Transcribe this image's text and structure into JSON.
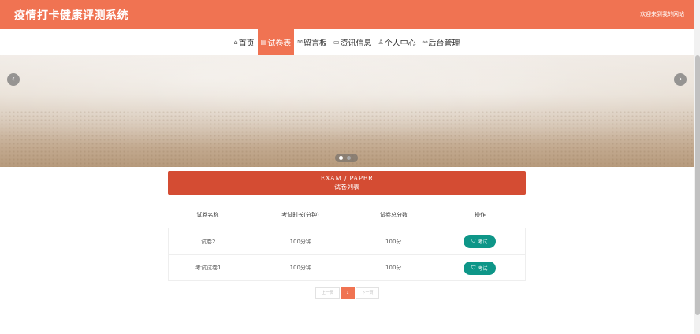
{
  "header": {
    "site_title": "疫情打卡健康评测系统",
    "welcome_text": "欢迎来到我的网站"
  },
  "nav": {
    "items": [
      {
        "icon": "home-icon",
        "label": "首页",
        "active": false
      },
      {
        "icon": "paper-icon",
        "label": "试卷表",
        "active": true
      },
      {
        "icon": "mail-icon",
        "label": "留言板",
        "active": false
      },
      {
        "icon": "news-icon",
        "label": "资讯信息",
        "active": false
      },
      {
        "icon": "user-icon",
        "label": "个人中心",
        "active": false
      },
      {
        "icon": "link-icon",
        "label": "后台管理",
        "active": false
      }
    ]
  },
  "banner": {
    "prev_icon": "chevron-left-icon",
    "next_icon": "chevron-right-icon",
    "active_slide": 1,
    "slide_count": 2
  },
  "section": {
    "title_en": "EXAM / PAPER",
    "title_cn": "试卷列表"
  },
  "table": {
    "headers": [
      "试卷名称",
      "考试时长(分钟)",
      "试卷总分数",
      "操作"
    ],
    "rows": [
      {
        "name": "试卷2",
        "duration": "100分钟",
        "score": "100分",
        "action": "考试"
      },
      {
        "name": "考试试卷1",
        "duration": "100分钟",
        "score": "100分",
        "action": "考试"
      }
    ]
  },
  "pagination": {
    "prev_label": "上一页",
    "current_page": "1",
    "next_label": "下一页"
  },
  "colors": {
    "brand": "#f07352",
    "section_title_bg": "#d44c33",
    "exam_button": "#0e9688"
  }
}
